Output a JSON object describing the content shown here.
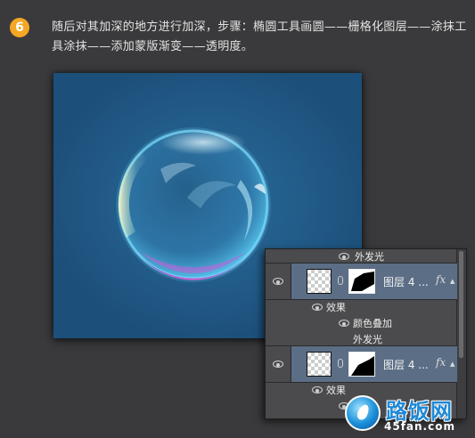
{
  "step": {
    "number": "6"
  },
  "instruction": "随后对其加深的地方进行加深，步骤：椭圆工具画圆——栅格化图层——涂抹工具涂抹——添加蒙版渐变——透明度。",
  "layers_panel": {
    "top_effect_label": "外发光",
    "layers": [
      {
        "name": "图层 4 ...",
        "fx": "fx",
        "effects_label": "效果",
        "effects": [
          "颜色叠加",
          "外发光"
        ]
      },
      {
        "name": "图层 4 ...",
        "fx": "fx",
        "effects_label": "效果",
        "effects": []
      }
    ]
  },
  "watermark": {
    "cn": "路饭网",
    "en": "45fan.com"
  },
  "colors": {
    "canvas_bg": "#1c4f79",
    "badge": "#f5a623",
    "layer_selected": "#5b6e86",
    "panel_bg": "#4b4b4d"
  }
}
